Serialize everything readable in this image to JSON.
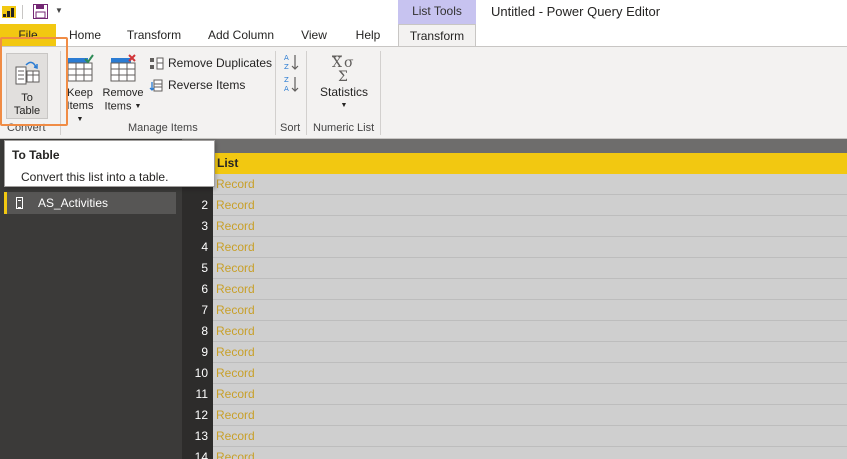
{
  "window": {
    "title": "Untitled - Power Query Editor",
    "context_group": "List Tools"
  },
  "tabs": [
    {
      "label": "File",
      "active": false
    },
    {
      "label": "Home",
      "active": false
    },
    {
      "label": "Transform",
      "active": false
    },
    {
      "label": "Add Column",
      "active": false
    },
    {
      "label": "View",
      "active": false
    },
    {
      "label": "Help",
      "active": false
    },
    {
      "label": "Transform",
      "active": true
    }
  ],
  "ribbon": {
    "convert": {
      "to_table_line1": "To",
      "to_table_line2": "Table",
      "group_label": "Convert"
    },
    "manage": {
      "keep_line1": "Keep",
      "keep_line2": "Items",
      "remove_line1": "Remove",
      "remove_line2": "Items",
      "remove_duplicates": "Remove Duplicates",
      "reverse_items": "Reverse Items",
      "group_label": "Manage Items"
    },
    "sort": {
      "group_label": "Sort"
    },
    "numeric": {
      "statistics": "Statistics",
      "group_label": "Numeric List"
    }
  },
  "tooltip": {
    "title": "To Table",
    "description": "Convert this list into a table."
  },
  "navigator": {
    "query_name": "AS_Activities"
  },
  "grid": {
    "column_header": "List",
    "rows": [
      {
        "num": "",
        "value": "Record"
      },
      {
        "num": "2",
        "value": "Record"
      },
      {
        "num": "3",
        "value": "Record"
      },
      {
        "num": "4",
        "value": "Record"
      },
      {
        "num": "5",
        "value": "Record"
      },
      {
        "num": "6",
        "value": "Record"
      },
      {
        "num": "7",
        "value": "Record"
      },
      {
        "num": "8",
        "value": "Record"
      },
      {
        "num": "9",
        "value": "Record"
      },
      {
        "num": "10",
        "value": "Record"
      },
      {
        "num": "11",
        "value": "Record"
      },
      {
        "num": "12",
        "value": "Record"
      },
      {
        "num": "13",
        "value": "Record"
      },
      {
        "num": "14",
        "value": "Record"
      }
    ]
  },
  "colors": {
    "accent": "#f2c811",
    "context_tab": "#c7c3f0",
    "highlight": "#f08c45",
    "record_text": "#c8a02a"
  }
}
